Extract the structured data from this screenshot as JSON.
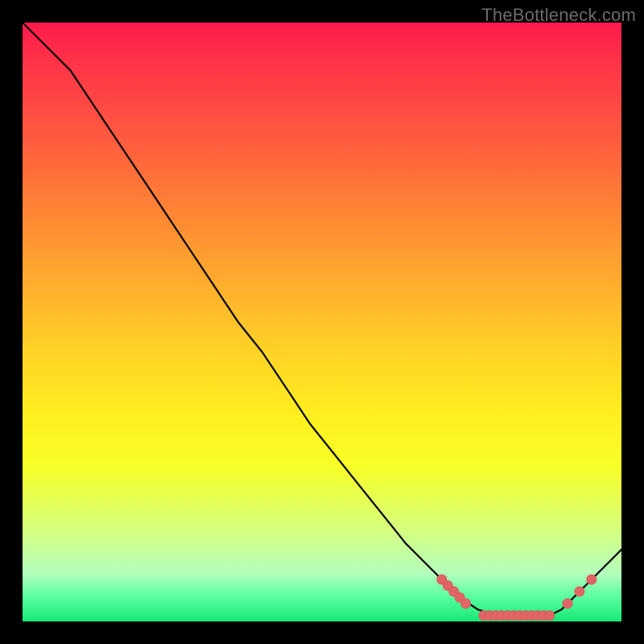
{
  "watermark": {
    "text": "TheBottleneck.com"
  },
  "colors": {
    "curve_stroke": "#000000",
    "marker_fill": "#e06666",
    "marker_stroke": "#d85a5a"
  },
  "chart_data": {
    "type": "line",
    "title": "",
    "xlabel": "",
    "ylabel": "",
    "xlim": [
      0,
      100
    ],
    "ylim": [
      0,
      100
    ],
    "series": [
      {
        "name": "curve",
        "x": [
          0,
          4,
          8,
          12,
          16,
          20,
          24,
          28,
          32,
          36,
          40,
          44,
          48,
          52,
          56,
          60,
          64,
          68,
          70,
          73,
          76,
          79,
          82,
          85,
          88,
          90,
          92,
          94,
          97,
          100
        ],
        "y": [
          100,
          96,
          92,
          86,
          80,
          74,
          68,
          62,
          56,
          50,
          45,
          39,
          33,
          28,
          23,
          18,
          13,
          9,
          7,
          4,
          2,
          1,
          1,
          1,
          1,
          2,
          4,
          6,
          9,
          12
        ]
      }
    ],
    "markers": [
      {
        "x": 70,
        "y": 7
      },
      {
        "x": 71,
        "y": 6
      },
      {
        "x": 72,
        "y": 5
      },
      {
        "x": 73,
        "y": 4
      },
      {
        "x": 74,
        "y": 3
      },
      {
        "x": 77,
        "y": 1
      },
      {
        "x": 78,
        "y": 1
      },
      {
        "x": 79,
        "y": 1
      },
      {
        "x": 80,
        "y": 1
      },
      {
        "x": 81,
        "y": 1
      },
      {
        "x": 82,
        "y": 1
      },
      {
        "x": 83,
        "y": 1
      },
      {
        "x": 84,
        "y": 1
      },
      {
        "x": 85,
        "y": 1
      },
      {
        "x": 86,
        "y": 1
      },
      {
        "x": 87,
        "y": 1
      },
      {
        "x": 88,
        "y": 1
      },
      {
        "x": 91,
        "y": 3
      },
      {
        "x": 93,
        "y": 5
      },
      {
        "x": 95,
        "y": 7
      }
    ]
  }
}
